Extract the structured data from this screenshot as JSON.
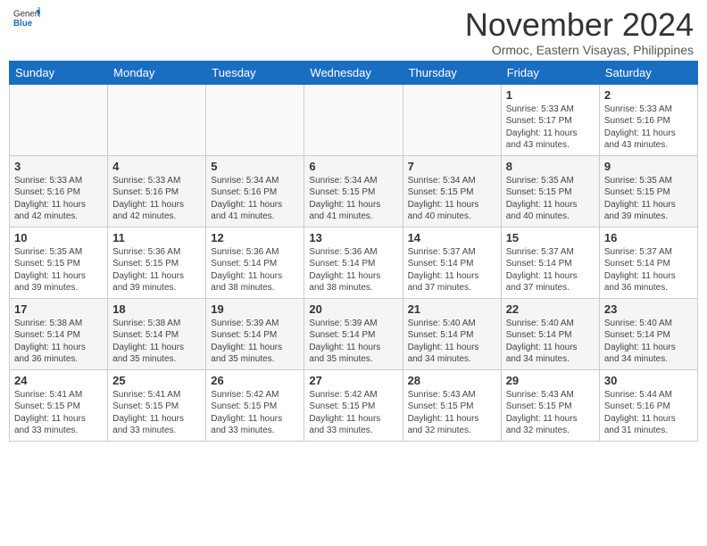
{
  "header": {
    "logo_general": "General",
    "logo_blue": "Blue",
    "month_title": "November 2024",
    "subtitle": "Ormoc, Eastern Visayas, Philippines"
  },
  "calendar": {
    "headers": [
      "Sunday",
      "Monday",
      "Tuesday",
      "Wednesday",
      "Thursday",
      "Friday",
      "Saturday"
    ],
    "weeks": [
      [
        {
          "day": "",
          "info": ""
        },
        {
          "day": "",
          "info": ""
        },
        {
          "day": "",
          "info": ""
        },
        {
          "day": "",
          "info": ""
        },
        {
          "day": "",
          "info": ""
        },
        {
          "day": "1",
          "info": "Sunrise: 5:33 AM\nSunset: 5:17 PM\nDaylight: 11 hours and 43 minutes."
        },
        {
          "day": "2",
          "info": "Sunrise: 5:33 AM\nSunset: 5:16 PM\nDaylight: 11 hours and 43 minutes."
        }
      ],
      [
        {
          "day": "3",
          "info": "Sunrise: 5:33 AM\nSunset: 5:16 PM\nDaylight: 11 hours and 42 minutes."
        },
        {
          "day": "4",
          "info": "Sunrise: 5:33 AM\nSunset: 5:16 PM\nDaylight: 11 hours and 42 minutes."
        },
        {
          "day": "5",
          "info": "Sunrise: 5:34 AM\nSunset: 5:16 PM\nDaylight: 11 hours and 41 minutes."
        },
        {
          "day": "6",
          "info": "Sunrise: 5:34 AM\nSunset: 5:15 PM\nDaylight: 11 hours and 41 minutes."
        },
        {
          "day": "7",
          "info": "Sunrise: 5:34 AM\nSunset: 5:15 PM\nDaylight: 11 hours and 40 minutes."
        },
        {
          "day": "8",
          "info": "Sunrise: 5:35 AM\nSunset: 5:15 PM\nDaylight: 11 hours and 40 minutes."
        },
        {
          "day": "9",
          "info": "Sunrise: 5:35 AM\nSunset: 5:15 PM\nDaylight: 11 hours and 39 minutes."
        }
      ],
      [
        {
          "day": "10",
          "info": "Sunrise: 5:35 AM\nSunset: 5:15 PM\nDaylight: 11 hours and 39 minutes."
        },
        {
          "day": "11",
          "info": "Sunrise: 5:36 AM\nSunset: 5:15 PM\nDaylight: 11 hours and 39 minutes."
        },
        {
          "day": "12",
          "info": "Sunrise: 5:36 AM\nSunset: 5:14 PM\nDaylight: 11 hours and 38 minutes."
        },
        {
          "day": "13",
          "info": "Sunrise: 5:36 AM\nSunset: 5:14 PM\nDaylight: 11 hours and 38 minutes."
        },
        {
          "day": "14",
          "info": "Sunrise: 5:37 AM\nSunset: 5:14 PM\nDaylight: 11 hours and 37 minutes."
        },
        {
          "day": "15",
          "info": "Sunrise: 5:37 AM\nSunset: 5:14 PM\nDaylight: 11 hours and 37 minutes."
        },
        {
          "day": "16",
          "info": "Sunrise: 5:37 AM\nSunset: 5:14 PM\nDaylight: 11 hours and 36 minutes."
        }
      ],
      [
        {
          "day": "17",
          "info": "Sunrise: 5:38 AM\nSunset: 5:14 PM\nDaylight: 11 hours and 36 minutes."
        },
        {
          "day": "18",
          "info": "Sunrise: 5:38 AM\nSunset: 5:14 PM\nDaylight: 11 hours and 35 minutes."
        },
        {
          "day": "19",
          "info": "Sunrise: 5:39 AM\nSunset: 5:14 PM\nDaylight: 11 hours and 35 minutes."
        },
        {
          "day": "20",
          "info": "Sunrise: 5:39 AM\nSunset: 5:14 PM\nDaylight: 11 hours and 35 minutes."
        },
        {
          "day": "21",
          "info": "Sunrise: 5:40 AM\nSunset: 5:14 PM\nDaylight: 11 hours and 34 minutes."
        },
        {
          "day": "22",
          "info": "Sunrise: 5:40 AM\nSunset: 5:14 PM\nDaylight: 11 hours and 34 minutes."
        },
        {
          "day": "23",
          "info": "Sunrise: 5:40 AM\nSunset: 5:14 PM\nDaylight: 11 hours and 34 minutes."
        }
      ],
      [
        {
          "day": "24",
          "info": "Sunrise: 5:41 AM\nSunset: 5:15 PM\nDaylight: 11 hours and 33 minutes."
        },
        {
          "day": "25",
          "info": "Sunrise: 5:41 AM\nSunset: 5:15 PM\nDaylight: 11 hours and 33 minutes."
        },
        {
          "day": "26",
          "info": "Sunrise: 5:42 AM\nSunset: 5:15 PM\nDaylight: 11 hours and 33 minutes."
        },
        {
          "day": "27",
          "info": "Sunrise: 5:42 AM\nSunset: 5:15 PM\nDaylight: 11 hours and 33 minutes."
        },
        {
          "day": "28",
          "info": "Sunrise: 5:43 AM\nSunset: 5:15 PM\nDaylight: 11 hours and 32 minutes."
        },
        {
          "day": "29",
          "info": "Sunrise: 5:43 AM\nSunset: 5:15 PM\nDaylight: 11 hours and 32 minutes."
        },
        {
          "day": "30",
          "info": "Sunrise: 5:44 AM\nSunset: 5:16 PM\nDaylight: 11 hours and 31 minutes."
        }
      ]
    ]
  }
}
